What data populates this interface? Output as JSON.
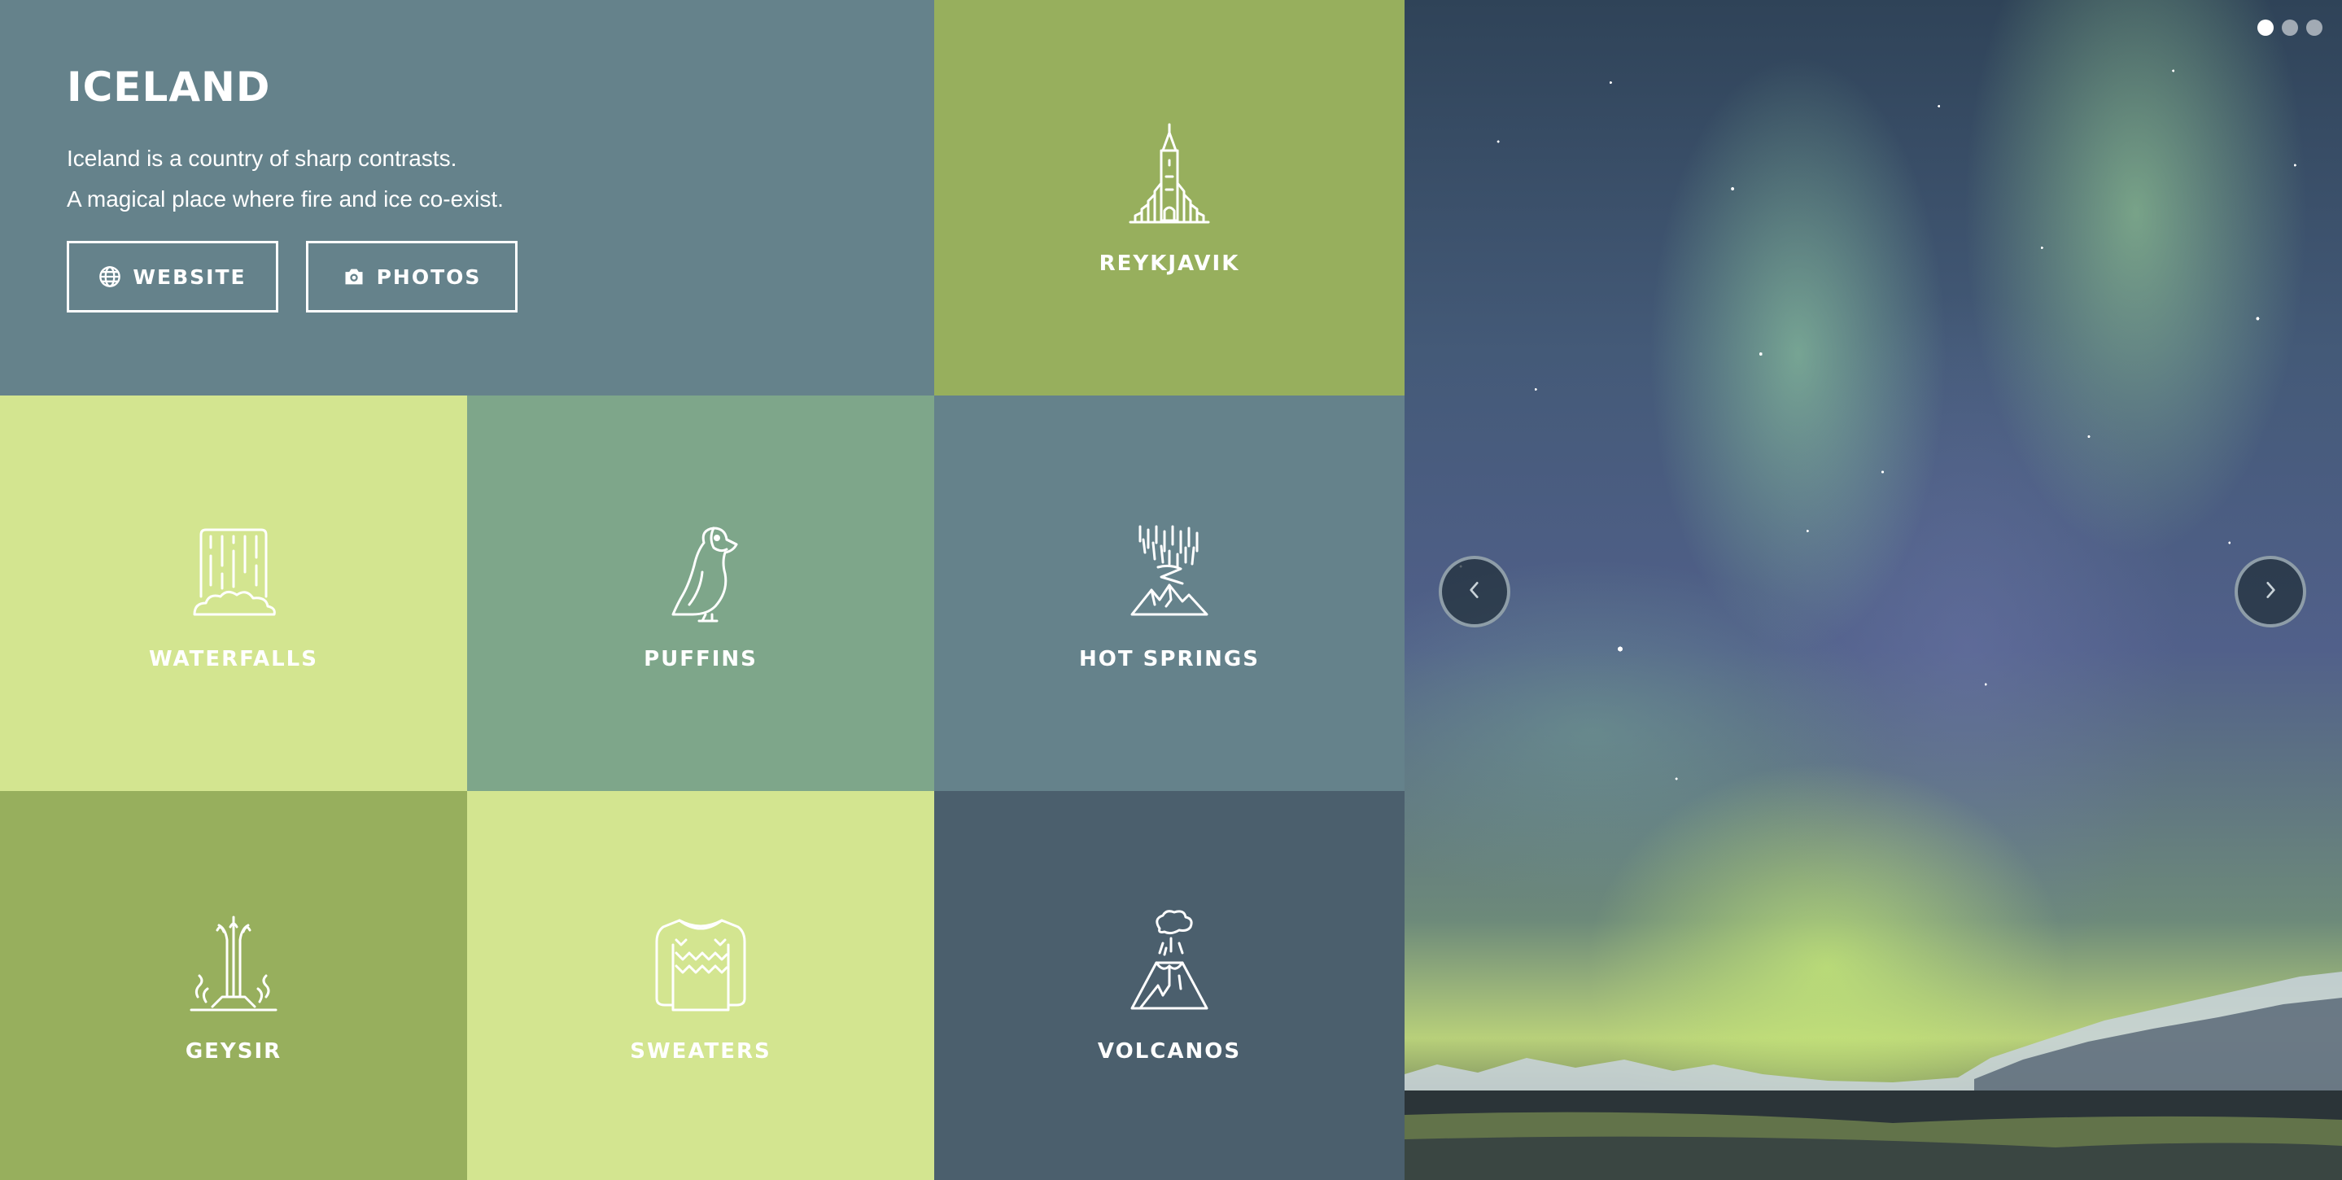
{
  "intro": {
    "title": "ICELAND",
    "line1": "Iceland is a country of sharp contrasts.",
    "line2": "A magical place where fire and ice co-exist.",
    "website_label": "WEBSITE",
    "photos_label": "PHOTOS",
    "icons": {
      "website": "globe-icon",
      "photos": "camera-icon"
    }
  },
  "tiles": [
    {
      "label": "REYKJAVIK",
      "icon": "church-icon",
      "color": "#97af5d"
    },
    {
      "label": "WATERFALLS",
      "icon": "waterfall-icon",
      "color": "#d3e590"
    },
    {
      "label": "PUFFINS",
      "icon": "puffin-icon",
      "color": "#7ea68a"
    },
    {
      "label": "HOT SPRINGS",
      "icon": "hot-springs-icon",
      "color": "#65828b"
    },
    {
      "label": "GEYSIR",
      "icon": "geyser-icon",
      "color": "#97af5d"
    },
    {
      "label": "SWEATERS",
      "icon": "sweater-icon",
      "color": "#d3e590"
    },
    {
      "label": "VOLCANOS",
      "icon": "volcano-icon",
      "color": "#4b5f6d"
    }
  ],
  "colors": {
    "intro_bg": "#65828b",
    "photo_nav_bg": "#23323c"
  },
  "carousel": {
    "image": "aurora-borealis-over-fjord",
    "slides": 3,
    "active_slide": 1,
    "prev_icon": "chevron-left-icon",
    "next_icon": "chevron-right-icon"
  }
}
